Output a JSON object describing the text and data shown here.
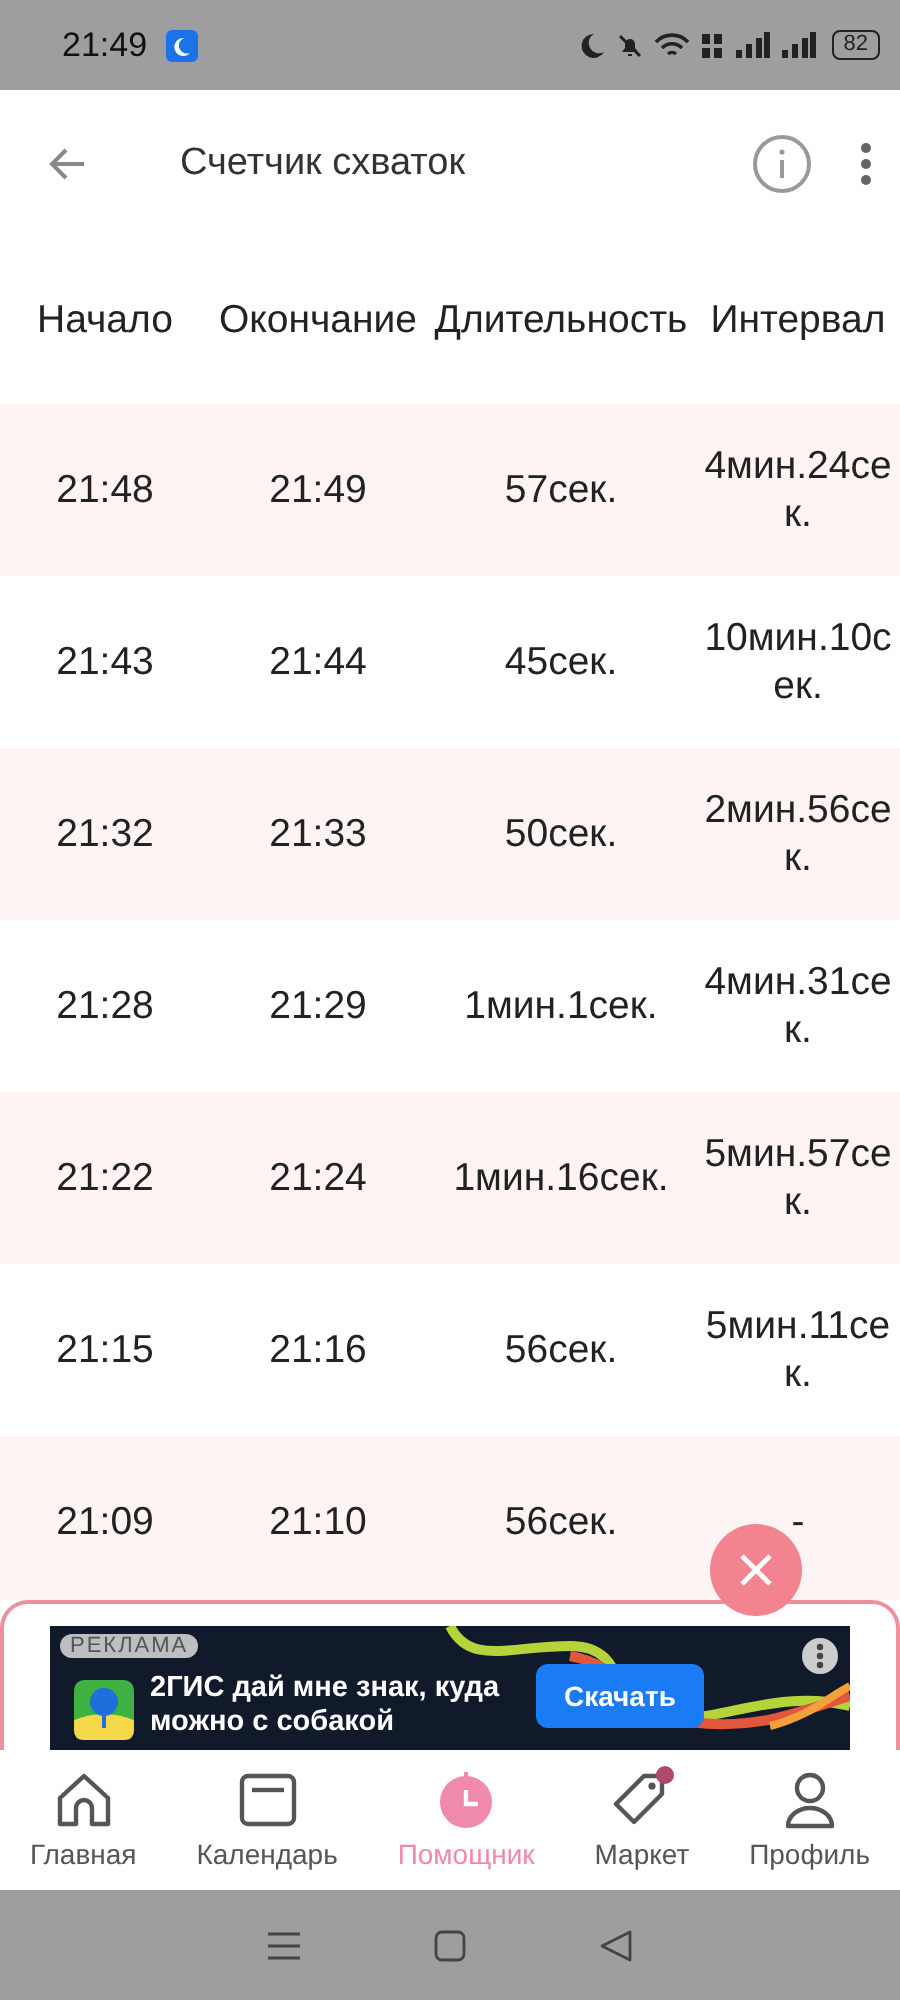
{
  "status_bar": {
    "time": "21:49",
    "battery": "82"
  },
  "header": {
    "title": "Счетчик схваток"
  },
  "table": {
    "columns": [
      "Начало",
      "Окончание",
      "Длительность",
      "Интервал"
    ],
    "rows": [
      {
        "start": "21:48",
        "end": "21:49",
        "duration": "57сек.",
        "interval": "4мин.24сек."
      },
      {
        "start": "21:43",
        "end": "21:44",
        "duration": "45сек.",
        "interval": "10мин.10сек."
      },
      {
        "start": "21:32",
        "end": "21:33",
        "duration": "50сек.",
        "interval": "2мин.56сек."
      },
      {
        "start": "21:28",
        "end": "21:29",
        "duration": "1мин.1сек.",
        "interval": "4мин.31сек."
      },
      {
        "start": "21:22",
        "end": "21:24",
        "duration": "1мин.16сек.",
        "interval": "5мин.57сек."
      },
      {
        "start": "21:15",
        "end": "21:16",
        "duration": "56сек.",
        "interval": "5мин.11сек."
      },
      {
        "start": "21:09",
        "end": "21:10",
        "duration": "56сек.",
        "interval": "-"
      }
    ]
  },
  "ad": {
    "badge": "РЕКЛАМА",
    "headline": "2ГИС дай мне знак, куда можно с собакой",
    "button": "Скачать"
  },
  "nav": [
    {
      "label": "Главная",
      "kind": "home",
      "selected": false,
      "badge": false
    },
    {
      "label": "Календарь",
      "kind": "calendar",
      "selected": false,
      "badge": false
    },
    {
      "label": "Помощник",
      "kind": "timer",
      "selected": true,
      "badge": false
    },
    {
      "label": "Маркет",
      "kind": "tag",
      "selected": false,
      "badge": true
    },
    {
      "label": "Профиль",
      "kind": "person",
      "selected": false,
      "badge": false
    }
  ]
}
